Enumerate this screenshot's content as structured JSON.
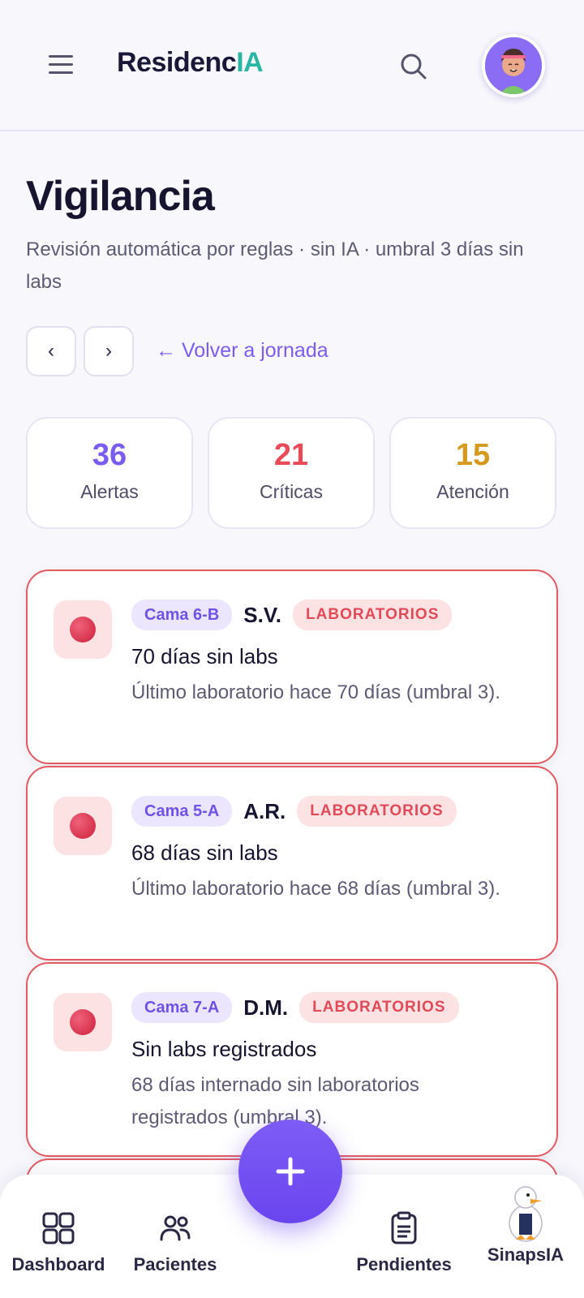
{
  "app": {
    "logo_main": "Residenc",
    "logo_accent": "IA"
  },
  "header": {
    "menu_icon": "menu-icon",
    "search_icon": "search-icon",
    "avatar_icon": "avatar"
  },
  "page": {
    "title": "Vigilancia",
    "subtitle": "Revisión automática por reglas · sin IA · umbral 3 días sin labs",
    "prev_label": "‹",
    "next_label": "›",
    "back_link": "← Volver a jornada"
  },
  "stats": [
    {
      "value": "36",
      "label": "Alertas",
      "color": "#7b5cf0"
    },
    {
      "value": "21",
      "label": "Críticas",
      "color": "#e84b57"
    },
    {
      "value": "15",
      "label": "Atención",
      "color": "#d49a1e"
    }
  ],
  "alerts": [
    {
      "bed": "Cama 6-B",
      "initials": "S.V.",
      "category": "LABORATORIOS",
      "title": "70 días sin labs",
      "desc": "Último laboratorio hace 70 días (umbral 3)."
    },
    {
      "bed": "Cama 5-A",
      "initials": "A.R.",
      "category": "LABORATORIOS",
      "title": "68 días sin labs",
      "desc": "Último laboratorio hace 68 días (umbral 3)."
    },
    {
      "bed": "Cama 7-A",
      "initials": "D.M.",
      "category": "LABORATORIOS",
      "title": "Sin labs registrados",
      "desc": "68 días internado sin laboratorios registrados (umbral 3)."
    }
  ],
  "fab": {
    "label": "+"
  },
  "bottom_nav": [
    {
      "label": "Dashboard",
      "icon": "dashboard-icon"
    },
    {
      "label": "Pacientes",
      "icon": "patients-icon"
    },
    {
      "label": "Pendientes",
      "icon": "clipboard-icon"
    },
    {
      "label": "SinapsIA",
      "icon": "duck-mascot-icon"
    }
  ],
  "colors": {
    "accent": "#7c5cf2",
    "critical": "#e45a63",
    "brand_ia": "#2bb6a3"
  }
}
